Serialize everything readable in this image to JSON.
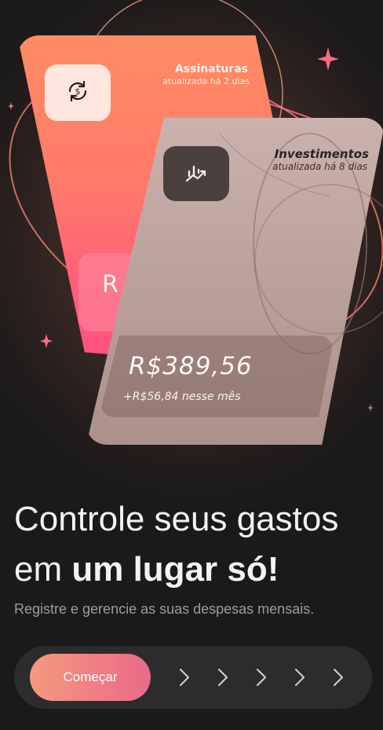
{
  "cards": {
    "back": {
      "title": "Assinaturas",
      "subtitle": "atualizada há 2 dias",
      "icon": "dollar-refresh-icon",
      "partial_amount": "R"
    },
    "front": {
      "title": "Investimentos",
      "subtitle": "atualizada há 8 dias",
      "icon": "chart-up-icon",
      "amount": "R$389,56",
      "change": "+R$56,84 nesse mês"
    }
  },
  "headline": {
    "line1": "Controle seus gastos",
    "line2_regular": "em ",
    "line2_strong": "um lugar só!"
  },
  "subtext": "Registre e gerencie as suas despesas mensais.",
  "cta": {
    "label": "Começar"
  },
  "swipe": {
    "chevrons": [
      "chevron-right-icon",
      "chevron-right-icon",
      "chevron-right-icon",
      "chevron-right-icon",
      "chevron-right-icon"
    ]
  },
  "colors": {
    "background": "#1c1a1a",
    "accent": "#f07e84",
    "card_back": "#ff7a6a",
    "card_front": "#bba19b"
  }
}
